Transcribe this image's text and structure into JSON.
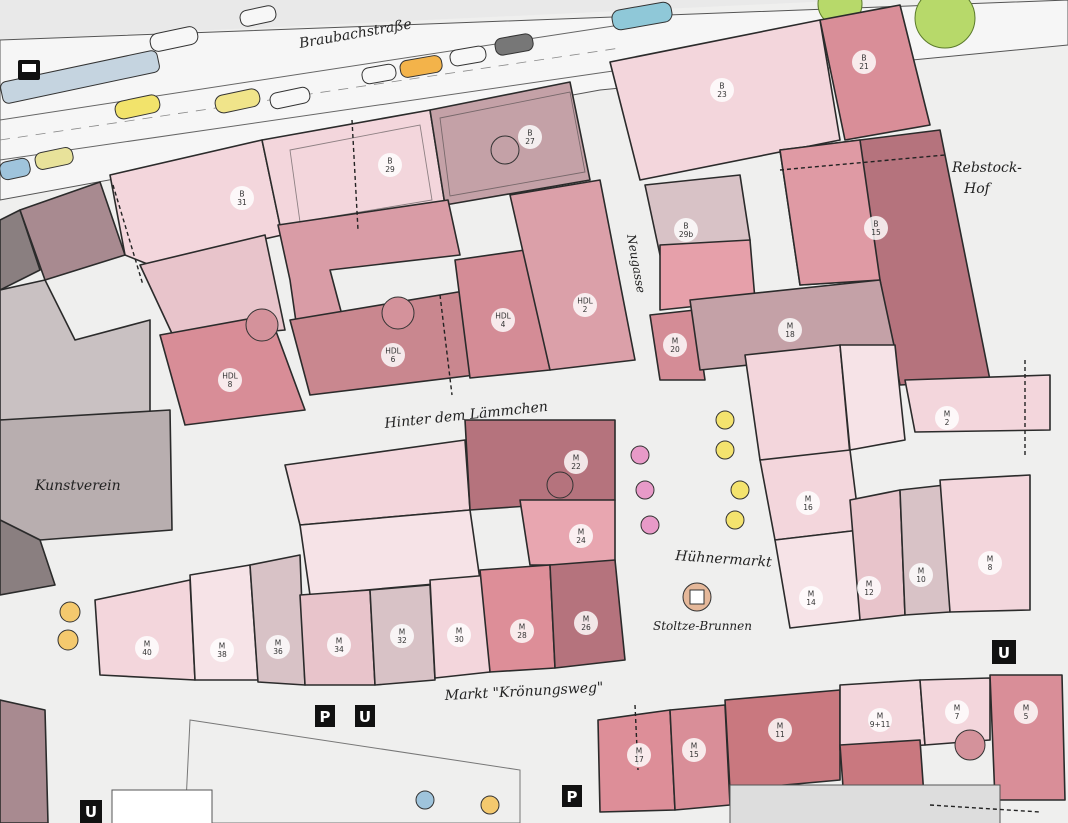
{
  "streets": {
    "braubachstrasse": "Braubachstraße",
    "hinter_dem_laemmchen": "Hinter dem Lämmchen",
    "markt_kroenungsweg": "Markt \"Krönungsweg\"",
    "neugasse": "Neugasse",
    "rebstock_hof_1": "Rebstock-",
    "rebstock_hof_2": "Hof",
    "huehnermarkt": "Hühnermarkt",
    "stoltze_brunnen": "Stoltze-Brunnen",
    "kunstverein": "Kunstverein"
  },
  "buildings": {
    "b21": [
      "B",
      "21"
    ],
    "b23": [
      "B",
      "23"
    ],
    "b27": [
      "B",
      "27"
    ],
    "b29": [
      "B",
      "29"
    ],
    "b31": [
      "B",
      "31"
    ],
    "b29b": [
      "B",
      "29b"
    ],
    "b15": [
      "B",
      "15"
    ],
    "hdl2": [
      "HDL",
      "2"
    ],
    "hdl4": [
      "HDL",
      "4"
    ],
    "hdl6": [
      "HDL",
      "6"
    ],
    "hdl8": [
      "HDL",
      "8"
    ],
    "m20": [
      "M",
      "20"
    ],
    "m18": [
      "M",
      "18"
    ],
    "m2": [
      "M",
      "2"
    ],
    "m22": [
      "M",
      "22"
    ],
    "m24": [
      "M",
      "24"
    ],
    "m16": [
      "M",
      "16"
    ],
    "m8": [
      "M",
      "8"
    ],
    "m10": [
      "M",
      "10"
    ],
    "m12": [
      "M",
      "12"
    ],
    "m14": [
      "M",
      "14"
    ],
    "m26": [
      "M",
      "26"
    ],
    "m28": [
      "M",
      "28"
    ],
    "m30": [
      "M",
      "30"
    ],
    "m32": [
      "M",
      "32"
    ],
    "m34": [
      "M",
      "34"
    ],
    "m36": [
      "M",
      "36"
    ],
    "m38": [
      "M",
      "38"
    ],
    "m40": [
      "M",
      "40"
    ],
    "m17": [
      "M",
      "17"
    ],
    "m15": [
      "M",
      "15"
    ],
    "m11": [
      "M",
      "11"
    ],
    "m9_11": [
      "M",
      "9+11"
    ],
    "m7": [
      "M",
      "7"
    ],
    "m5": [
      "M",
      "5"
    ]
  },
  "signs": {
    "parking": "P",
    "ubahn": "U"
  },
  "colors": {
    "ground": "#efefee",
    "pink_light": "#f3d6dc",
    "pink_mid": "#e8a6b0",
    "rose_dark": "#b57e86",
    "mauve": "#a88a90",
    "gray_dark": "#8a7f80",
    "green": "#b7d96a"
  }
}
